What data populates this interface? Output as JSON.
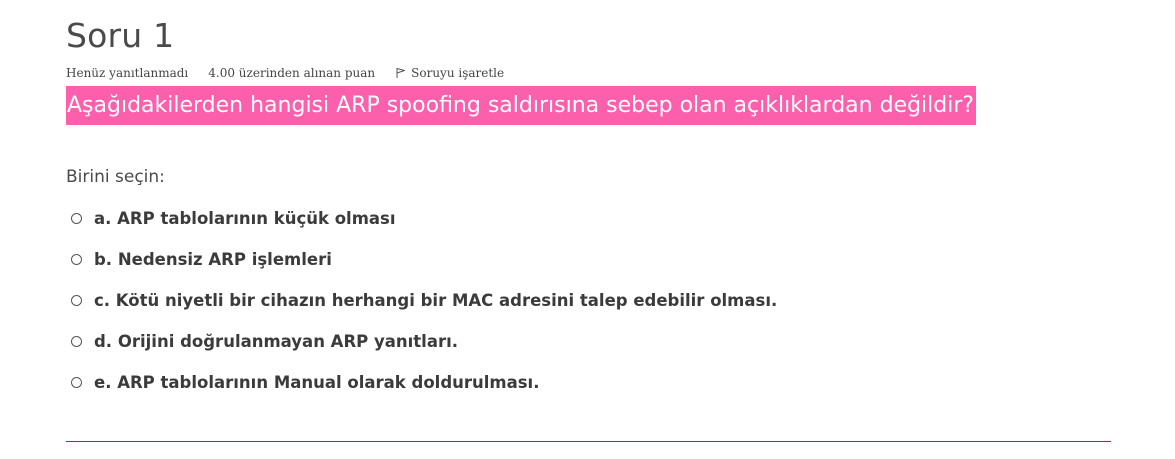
{
  "question": {
    "title": "Soru 1",
    "state": "Henüz yanıtlanmadı",
    "grade": "4.00 üzerinden alınan puan",
    "flag_label": "Soruyu işaretle",
    "text": "Aşağıdakilerden hangisi ARP spoofing saldırısına sebep olan açıklıklardan değildir?",
    "highlight_color": "#fc5fab",
    "prompt": "Birini seçin:",
    "answers": [
      {
        "label": "a. ARP tablolarının küçük olması"
      },
      {
        "label": "b. Nedensiz ARP işlemleri"
      },
      {
        "label": "c. Kötü niyetli bir cihazın herhangi bir MAC adresini talep edebilir olması."
      },
      {
        "label": "d. Orijini doğrulanmayan ARP yanıtları."
      },
      {
        "label": "e. ARP tablolarının Manual olarak doldurulması."
      }
    ]
  }
}
